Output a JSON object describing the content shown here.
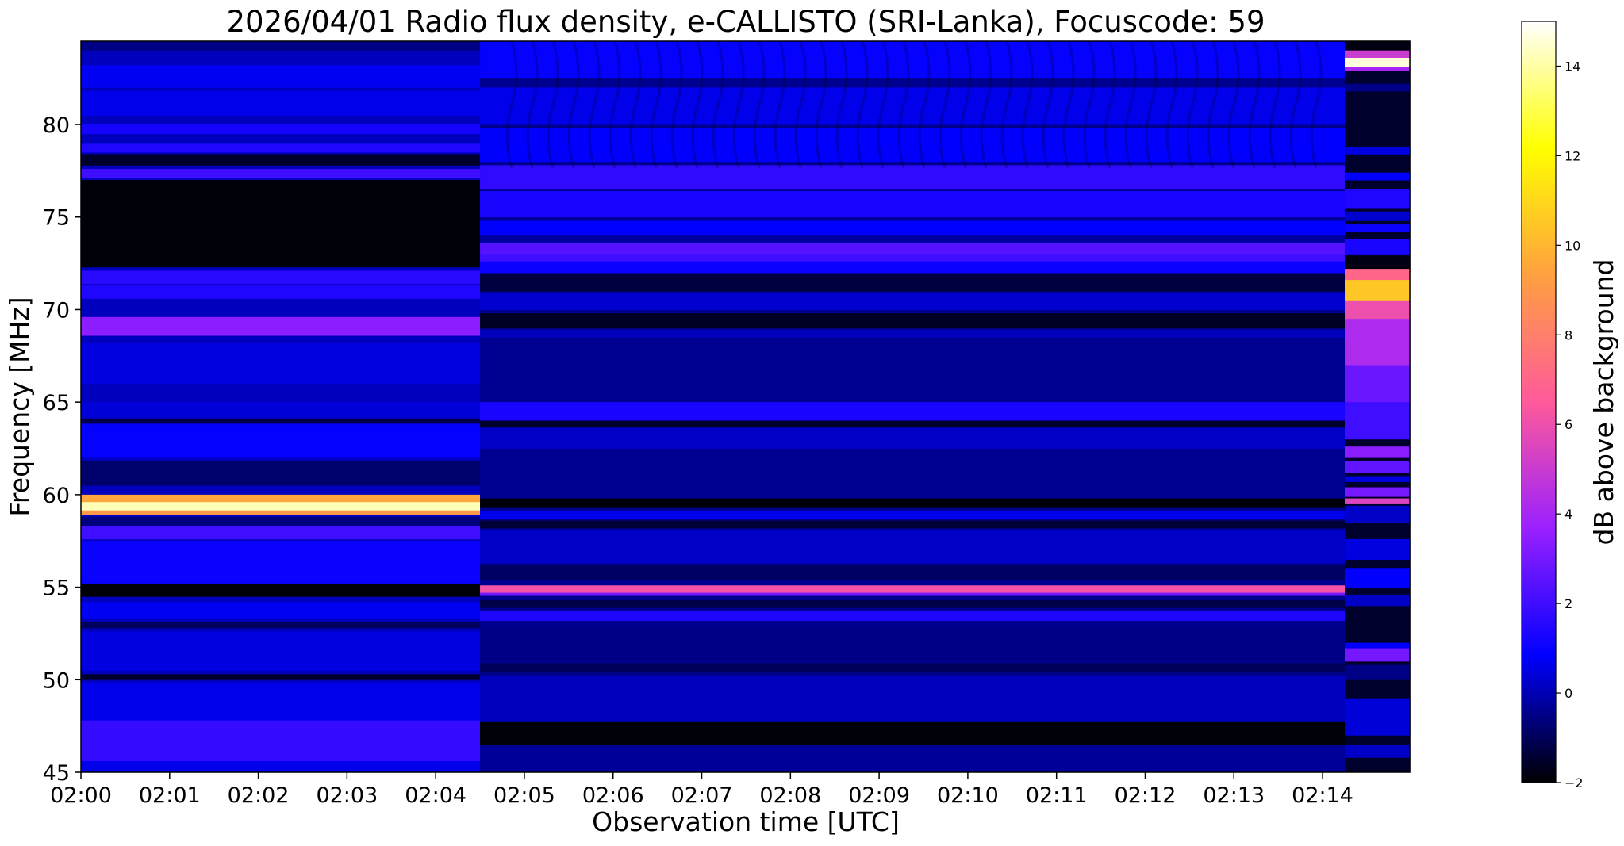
{
  "chart_data": {
    "type": "heatmap",
    "title": "2026/04/01  Radio flux density, e-CALLISTO (SRI-Lanka), Focuscode: 59",
    "xlabel": "Observation time [UTC]",
    "ylabel": "Frequency [MHz]",
    "colorbar_label": "dB above background",
    "colormap": "gnuplot2",
    "colormap_stops": [
      "#000000",
      "#0000ff",
      "#9a20ff",
      "#ff5a9a",
      "#ffa040",
      "#ffff00",
      "#ffffff"
    ],
    "xlim": [
      "02:00:00",
      "02:14:59"
    ],
    "ylim": [
      45,
      84.5
    ],
    "clim": [
      -2,
      15
    ],
    "x_ticks": [
      "02:00",
      "02:01",
      "02:02",
      "02:03",
      "02:04",
      "02:05",
      "02:06",
      "02:07",
      "02:08",
      "02:09",
      "02:10",
      "02:11",
      "02:12",
      "02:13",
      "02:14"
    ],
    "y_ticks": [
      45,
      50,
      55,
      60,
      65,
      70,
      75,
      80
    ],
    "colorbar_ticks": [
      -2,
      0,
      2,
      4,
      6,
      8,
      10,
      12,
      14
    ],
    "segments": [
      {
        "start": "02:00:00",
        "end": "02:04:30",
        "background": 0.1,
        "bands": [
          {
            "lo": 84.0,
            "hi": 84.5,
            "value": -0.5
          },
          {
            "lo": 82.0,
            "hi": 83.2,
            "value": 0.7
          },
          {
            "lo": 80.5,
            "hi": 81.8,
            "value": 0.6
          },
          {
            "lo": 79.5,
            "hi": 80.0,
            "value": 1.2
          },
          {
            "lo": 78.5,
            "hi": 79.0,
            "value": 1.4
          },
          {
            "lo": 77.8,
            "hi": 78.4,
            "value": -1.5
          },
          {
            "lo": 77.1,
            "hi": 77.6,
            "value": 2.0
          },
          {
            "lo": 72.3,
            "hi": 77.0,
            "value": -1.9
          },
          {
            "lo": 71.4,
            "hi": 72.1,
            "value": 1.6
          },
          {
            "lo": 70.6,
            "hi": 71.3,
            "value": 1.4
          },
          {
            "lo": 68.6,
            "hi": 69.6,
            "value": 3.4
          },
          {
            "lo": 66.0,
            "hi": 68.2,
            "value": 0.5
          },
          {
            "lo": 64.2,
            "hi": 65.0,
            "value": 0.4
          },
          {
            "lo": 63.9,
            "hi": 64.1,
            "value": -1.2
          },
          {
            "lo": 62.0,
            "hi": 63.8,
            "value": 0.9
          },
          {
            "lo": 60.5,
            "hi": 61.8,
            "value": -0.8
          },
          {
            "lo": 59.6,
            "hi": 60.0,
            "value": 9.5
          },
          {
            "lo": 59.15,
            "hi": 59.6,
            "value": 14.2
          },
          {
            "lo": 58.9,
            "hi": 59.15,
            "value": 9.0
          },
          {
            "lo": 58.3,
            "hi": 58.8,
            "value": -0.6
          },
          {
            "lo": 57.6,
            "hi": 58.3,
            "value": 2.0
          },
          {
            "lo": 55.2,
            "hi": 57.5,
            "value": 1.0
          },
          {
            "lo": 54.5,
            "hi": 55.2,
            "value": -1.9
          },
          {
            "lo": 53.3,
            "hi": 54.2,
            "value": 0.7
          },
          {
            "lo": 52.8,
            "hi": 53.1,
            "value": -1.0
          },
          {
            "lo": 50.5,
            "hi": 52.6,
            "value": 0.5
          },
          {
            "lo": 50.0,
            "hi": 50.3,
            "value": -1.5
          },
          {
            "lo": 47.8,
            "hi": 49.8,
            "value": 0.6
          },
          {
            "lo": 45.6,
            "hi": 47.8,
            "value": 1.8
          },
          {
            "lo": 45.0,
            "hi": 45.6,
            "value": 0.6
          }
        ]
      },
      {
        "start": "02:04:30",
        "end": "02:14:15",
        "background": -0.4,
        "bands": [
          {
            "lo": 82.5,
            "hi": 84.5,
            "value": 0.9
          },
          {
            "lo": 80.0,
            "hi": 82.0,
            "value": 0.6
          },
          {
            "lo": 78.0,
            "hi": 79.8,
            "value": 0.8
          },
          {
            "lo": 76.5,
            "hi": 77.8,
            "value": 1.7
          },
          {
            "lo": 75.0,
            "hi": 76.4,
            "value": 1.3
          },
          {
            "lo": 74.0,
            "hi": 74.8,
            "value": 0.8
          },
          {
            "lo": 73.6,
            "hi": 74.0,
            "value": -0.2
          },
          {
            "lo": 73.0,
            "hi": 73.6,
            "value": 2.4
          },
          {
            "lo": 72.6,
            "hi": 73.0,
            "value": 2.0
          },
          {
            "lo": 72.0,
            "hi": 72.6,
            "value": 1.0
          },
          {
            "lo": 71.0,
            "hi": 71.9,
            "value": -1.3
          },
          {
            "lo": 70.0,
            "hi": 70.9,
            "value": 0.3
          },
          {
            "lo": 69.0,
            "hi": 69.8,
            "value": -1.6
          },
          {
            "lo": 68.5,
            "hi": 68.9,
            "value": 0.1
          },
          {
            "lo": 64.0,
            "hi": 65.0,
            "value": 1.3
          },
          {
            "lo": 63.7,
            "hi": 64.0,
            "value": -1.5
          },
          {
            "lo": 62.5,
            "hi": 63.6,
            "value": 0.2
          },
          {
            "lo": 59.3,
            "hi": 59.8,
            "value": -1.9
          },
          {
            "lo": 58.7,
            "hi": 59.1,
            "value": 0.6
          },
          {
            "lo": 58.2,
            "hi": 58.6,
            "value": -1.4
          },
          {
            "lo": 56.3,
            "hi": 58.1,
            "value": 0.2
          },
          {
            "lo": 55.4,
            "hi": 56.2,
            "value": -0.9
          },
          {
            "lo": 54.7,
            "hi": 55.1,
            "value": 6.2
          },
          {
            "lo": 54.55,
            "hi": 54.7,
            "value": 3.0
          },
          {
            "lo": 53.9,
            "hi": 54.3,
            "value": -1.2
          },
          {
            "lo": 53.2,
            "hi": 53.7,
            "value": 1.4
          },
          {
            "lo": 51.0,
            "hi": 52.8,
            "value": -0.5
          },
          {
            "lo": 50.4,
            "hi": 50.9,
            "value": -1.0
          },
          {
            "lo": 47.8,
            "hi": 50.2,
            "value": 0.1
          },
          {
            "lo": 46.5,
            "hi": 47.7,
            "value": -1.9
          },
          {
            "lo": 45.0,
            "hi": 46.3,
            "value": -0.3
          }
        ]
      },
      {
        "start": "02:14:15",
        "end": "02:14:59",
        "background": -1.5,
        "bands": [
          {
            "lo": 84.0,
            "hi": 84.5,
            "value": -1.8
          },
          {
            "lo": 83.6,
            "hi": 84.0,
            "value": 5.0
          },
          {
            "lo": 83.1,
            "hi": 83.6,
            "value": 14.6
          },
          {
            "lo": 82.9,
            "hi": 83.1,
            "value": 4.0
          },
          {
            "lo": 81.8,
            "hi": 82.2,
            "value": -0.5
          },
          {
            "lo": 78.4,
            "hi": 78.8,
            "value": 0.5
          },
          {
            "lo": 77.0,
            "hi": 77.4,
            "value": 0.8
          },
          {
            "lo": 75.5,
            "hi": 76.5,
            "value": 1.4
          },
          {
            "lo": 74.8,
            "hi": 75.3,
            "value": 0.3
          },
          {
            "lo": 74.2,
            "hi": 74.6,
            "value": 1.0
          },
          {
            "lo": 73.0,
            "hi": 73.8,
            "value": 1.3
          },
          {
            "lo": 72.2,
            "hi": 72.9,
            "value": -1.8
          },
          {
            "lo": 71.6,
            "hi": 72.2,
            "value": 7.0
          },
          {
            "lo": 70.5,
            "hi": 71.6,
            "value": 10.5
          },
          {
            "lo": 69.5,
            "hi": 70.5,
            "value": 6.0
          },
          {
            "lo": 67.0,
            "hi": 69.5,
            "value": 4.2
          },
          {
            "lo": 65.0,
            "hi": 67.0,
            "value": 2.8
          },
          {
            "lo": 63.0,
            "hi": 65.0,
            "value": 2.0
          },
          {
            "lo": 62.0,
            "hi": 62.6,
            "value": 3.4
          },
          {
            "lo": 61.2,
            "hi": 61.8,
            "value": 2.6
          },
          {
            "lo": 60.7,
            "hi": 61.0,
            "value": 0.5
          },
          {
            "lo": 59.9,
            "hi": 60.4,
            "value": 3.0
          },
          {
            "lo": 59.5,
            "hi": 59.8,
            "value": 5.5
          },
          {
            "lo": 58.5,
            "hi": 59.4,
            "value": 0.2
          },
          {
            "lo": 56.5,
            "hi": 57.6,
            "value": 0.5
          },
          {
            "lo": 55.0,
            "hi": 56.0,
            "value": 0.8
          },
          {
            "lo": 54.0,
            "hi": 54.6,
            "value": 0.2
          },
          {
            "lo": 51.7,
            "hi": 52.0,
            "value": 0.8
          },
          {
            "lo": 51.0,
            "hi": 51.7,
            "value": 3.0
          },
          {
            "lo": 50.0,
            "hi": 50.8,
            "value": -0.5
          },
          {
            "lo": 47.0,
            "hi": 49.0,
            "value": 0.4
          },
          {
            "lo": 45.8,
            "hi": 46.5,
            "value": 0.2
          }
        ]
      }
    ]
  }
}
